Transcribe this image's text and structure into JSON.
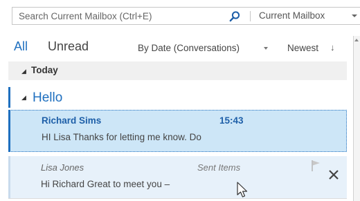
{
  "search": {
    "placeholder": "Search Current Mailbox (Ctrl+E)",
    "scope": "Current Mailbox"
  },
  "filters": {
    "all": "All",
    "unread": "Unread",
    "sort_by": "By Date (Conversations)",
    "order": "Newest",
    "order_arrow": "↓"
  },
  "groups": {
    "today": "Today",
    "collapse_glyph": "◢"
  },
  "conversation": {
    "title": "Hello",
    "messages": [
      {
        "sender": "Richard Sims",
        "time": "15:43",
        "preview": "HI Lisa  Thanks for letting me know. Do"
      },
      {
        "sender": "Lisa Jones",
        "folder": "Sent Items",
        "preview": "Hi Richard  Great to meet you –"
      }
    ]
  },
  "icons": {
    "search": "search-icon",
    "scope_dropdown": "chevron-down-icon",
    "flag": "flag-icon",
    "delete": "close-icon",
    "cursor": "mouse-pointer-icon"
  },
  "colors": {
    "accent": "#1e6fbf",
    "selected_bg": "#cde6f7",
    "secondary_bg": "#e7f1fa",
    "group_bg": "#f0f0f0"
  }
}
